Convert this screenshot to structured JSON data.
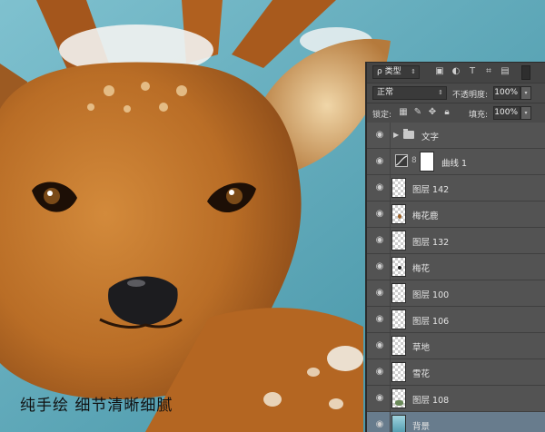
{
  "caption": "纯手绘  细节清晰细腻",
  "colors": {
    "panel_bg": "#535353",
    "selected_row": "#687c8d",
    "fur": "#c1782f",
    "sky": "#5aa4b4"
  },
  "toolbar": {
    "filter_kind": "ρ 类型",
    "blend_mode": "正常",
    "opacity_label": "不透明度:",
    "opacity_value": "100%",
    "lock_label": "锁定:",
    "fill_label": "填充:",
    "fill_value": "100%",
    "icons": [
      "image-filter-icon",
      "adjustment-filter-icon",
      "type-filter-icon",
      "shape-filter-icon",
      "smart-object-filter-icon",
      "filter-toggle-icon",
      "lock-pixels-icon",
      "lock-paint-icon",
      "lock-move-icon",
      "lock-all-icon"
    ]
  },
  "layers": [
    {
      "name": "文字",
      "kind": "group"
    },
    {
      "name": "曲线 1",
      "kind": "adjustment"
    },
    {
      "name": "图层 142",
      "kind": "pixel"
    },
    {
      "name": "梅花鹿",
      "kind": "pixel"
    },
    {
      "name": "图层 132",
      "kind": "pixel"
    },
    {
      "name": "梅花",
      "kind": "pixel"
    },
    {
      "name": "图层 100",
      "kind": "pixel"
    },
    {
      "name": "图层 106",
      "kind": "pixel"
    },
    {
      "name": "草地",
      "kind": "pixel"
    },
    {
      "name": "雪花",
      "kind": "pixel"
    },
    {
      "name": "图层 108",
      "kind": "pixel"
    },
    {
      "name": "背景",
      "kind": "background",
      "selected": true
    }
  ]
}
